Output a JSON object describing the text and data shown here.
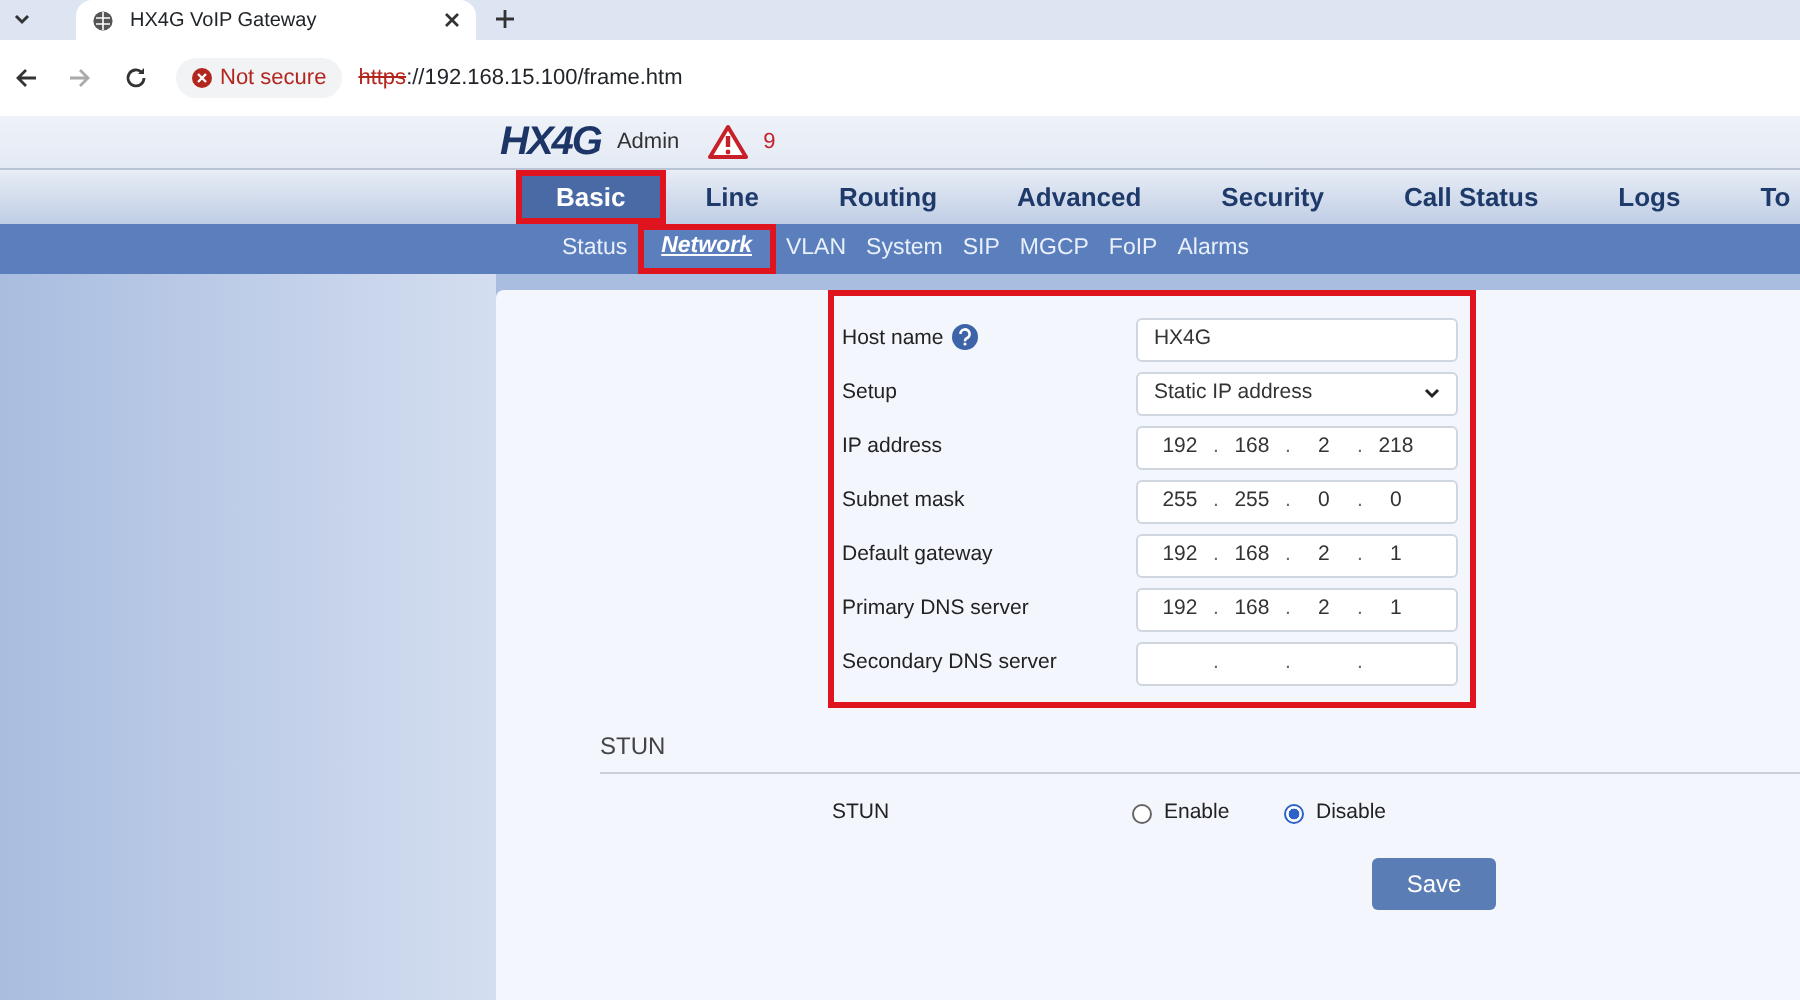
{
  "browser": {
    "tab_title": "HX4G VoIP Gateway",
    "security_label": "Not secure",
    "url_scheme": "https",
    "url_rest": "://192.168.15.100/frame.htm",
    "forward_disabled": true
  },
  "header": {
    "logo": "HX4G",
    "user": "Admin",
    "alarm_count": "9"
  },
  "tabs": [
    {
      "label": "Basic",
      "selected": true,
      "highlighted": true
    },
    {
      "label": "Line",
      "selected": false,
      "highlighted": false
    },
    {
      "label": "Routing",
      "selected": false,
      "highlighted": false
    },
    {
      "label": "Advanced",
      "selected": false,
      "highlighted": false
    },
    {
      "label": "Security",
      "selected": false,
      "highlighted": false
    },
    {
      "label": "Call Status",
      "selected": false,
      "highlighted": false
    },
    {
      "label": "Logs",
      "selected": false,
      "highlighted": false
    },
    {
      "label": "To",
      "selected": false,
      "highlighted": false
    }
  ],
  "subtabs": [
    {
      "label": "Status",
      "selected": false,
      "highlighted": false
    },
    {
      "label": "Network",
      "selected": true,
      "highlighted": true
    },
    {
      "label": "VLAN",
      "selected": false,
      "highlighted": false
    },
    {
      "label": "System",
      "selected": false,
      "highlighted": false
    },
    {
      "label": "SIP",
      "selected": false,
      "highlighted": false
    },
    {
      "label": "MGCP",
      "selected": false,
      "highlighted": false
    },
    {
      "label": "FoIP",
      "selected": false,
      "highlighted": false
    },
    {
      "label": "Alarms",
      "selected": false,
      "highlighted": false
    }
  ],
  "network_form": {
    "highlighted": true,
    "rows": [
      {
        "kind": "text",
        "label": "Host name",
        "help": true,
        "value": "HX4G"
      },
      {
        "kind": "select",
        "label": "Setup",
        "value": "Static IP address"
      },
      {
        "kind": "ip",
        "label": "IP address",
        "octets": [
          "192",
          "168",
          "2",
          "218"
        ],
        "separators": [
          ".",
          ".",
          "."
        ]
      },
      {
        "kind": "ip",
        "label": "Subnet mask",
        "octets": [
          "255",
          "255",
          "0",
          "0"
        ],
        "separators": [
          ".",
          ".",
          "."
        ]
      },
      {
        "kind": "ip",
        "label": "Default gateway",
        "octets": [
          "192",
          "168",
          "2",
          "1"
        ],
        "separators": [
          ".",
          ".",
          "."
        ]
      },
      {
        "kind": "ip",
        "label": "Primary DNS server",
        "octets": [
          "192",
          "168",
          "2",
          "1"
        ],
        "separators": [
          ".",
          ".",
          "."
        ]
      },
      {
        "kind": "ip",
        "label": "Secondary DNS server",
        "separators": [
          ".",
          ".",
          "."
        ]
      }
    ]
  },
  "stun": {
    "heading": "STUN",
    "label": "STUN",
    "options": [
      {
        "label": "Enable",
        "selected": false
      },
      {
        "label": "Disable",
        "selected": true
      }
    ]
  },
  "buttons": [
    "Save"
  ]
}
